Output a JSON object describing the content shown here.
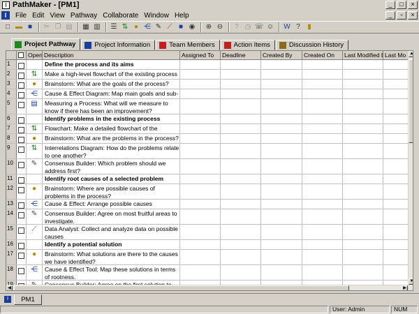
{
  "window": {
    "title": "PathMaker - [PM1]"
  },
  "menu": [
    "File",
    "Edit",
    "View",
    "Pathway",
    "Collaborate",
    "Window",
    "Help"
  ],
  "tabs": [
    {
      "label": "Project Pathway",
      "icon": "pathway-icon",
      "color": "#1a8a1a"
    },
    {
      "label": "Project Information",
      "icon": "info-icon",
      "color": "#1a3d9c"
    },
    {
      "label": "Team Members",
      "icon": "team-icon",
      "color": "#c02020"
    },
    {
      "label": "Action Items",
      "icon": "action-items-icon",
      "color": "#c02020"
    },
    {
      "label": "Discussion History",
      "icon": "discussion-icon",
      "color": "#8a6a20"
    }
  ],
  "columns": [
    "",
    "",
    "Open",
    "Description",
    "Assigned To",
    "Deadline",
    "Created By",
    "Created On",
    "Last Modified By",
    "Last Mo"
  ],
  "rows": [
    {
      "num": "1",
      "desc": "Define the process and its aims",
      "bold": true,
      "icon": ""
    },
    {
      "num": "2",
      "desc": "Make a high-level flowchart of the existing process",
      "bold": false,
      "icon": "flowchart-icon"
    },
    {
      "num": "3",
      "desc": "Brainstorm: What are the goals of the process?",
      "bold": false,
      "icon": "brainstorm-icon"
    },
    {
      "num": "4",
      "desc": "Cause & Effect Diagram: Map main goals and sub-goals",
      "bold": false,
      "icon": "cause-effect-icon"
    },
    {
      "num": "5",
      "desc": "Measuring a Process: What will we measure to know if there has been an improvement?",
      "bold": false,
      "icon": "measure-icon"
    },
    {
      "num": "6",
      "desc": "Identify problems in the existing process",
      "bold": true,
      "icon": ""
    },
    {
      "num": "7",
      "desc": "Flowchart: Make a detailed flowchart of the process",
      "bold": false,
      "icon": "flowchart-icon"
    },
    {
      "num": "8",
      "desc": "Brainstorm: What are the problems in the process?",
      "bold": false,
      "icon": "brainstorm-icon"
    },
    {
      "num": "9",
      "desc": "Interrelations Diagram: How do the problems relate to one another?",
      "bold": false,
      "icon": "flowchart-icon"
    },
    {
      "num": "10",
      "desc": "Consensus Builder: Which problem should we address first?",
      "bold": false,
      "icon": "consensus-icon"
    },
    {
      "num": "11",
      "desc": "Identify root causes of a selected problem",
      "bold": true,
      "icon": ""
    },
    {
      "num": "12",
      "desc": "Brainstorm: Where are possible causes of problems in the process?",
      "bold": false,
      "icon": "brainstorm-icon"
    },
    {
      "num": "13",
      "desc": "Cause & Effect: Arrange possible causes",
      "bold": false,
      "icon": "cause-effect-icon"
    },
    {
      "num": "14",
      "desc": "Consensus Builder: Agree on most fruitful areas to investigate.",
      "bold": false,
      "icon": "consensus-icon"
    },
    {
      "num": "15",
      "desc": "Data Analyst: Collect and analyze data on possible causes",
      "bold": false,
      "icon": "data-analyst-icon"
    },
    {
      "num": "16",
      "desc": "Identify a potential solution",
      "bold": true,
      "icon": ""
    },
    {
      "num": "17",
      "desc": "Brainstorm: What solutions are there to the causes we have identified?",
      "bold": false,
      "icon": "brainstorm-icon"
    },
    {
      "num": "18",
      "desc": "Cause & Effect Tool: Map these solutions in terms of rootness.",
      "bold": false,
      "icon": "cause-effect-icon"
    },
    {
      "num": "19",
      "desc": "Consensus Builder: Agree on the first solution to try.",
      "bold": false,
      "icon": "consensus-icon"
    }
  ],
  "mdi": {
    "tab": "PM1"
  },
  "status": {
    "user": "User: Admin",
    "num": "NUM"
  }
}
